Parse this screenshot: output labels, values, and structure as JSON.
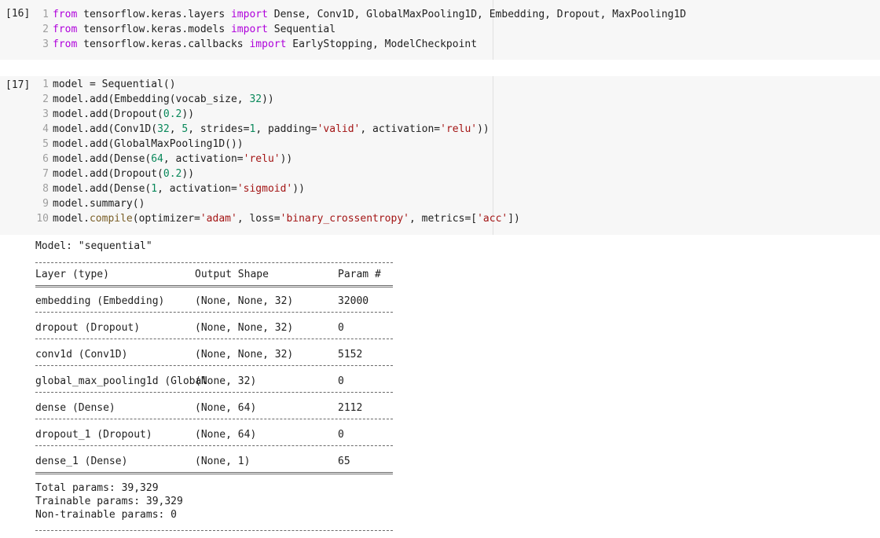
{
  "cells": [
    {
      "label": "[16]",
      "lines": [
        {
          "num": "1",
          "segments": [
            [
              "kw",
              "from"
            ],
            [
              "txt",
              " tensorflow.keras.layers "
            ],
            [
              "kw",
              "import"
            ],
            [
              "txt",
              " Dense, Conv1D, GlobalMaxPooling1D, Embedding, Dropout, MaxPooling1D"
            ]
          ]
        },
        {
          "num": "2",
          "segments": [
            [
              "kw",
              "from"
            ],
            [
              "txt",
              " tensorflow.keras.models "
            ],
            [
              "kw",
              "import"
            ],
            [
              "txt",
              " Sequential"
            ]
          ]
        },
        {
          "num": "3",
          "segments": [
            [
              "kw",
              "from"
            ],
            [
              "txt",
              " tensorflow.keras.callbacks "
            ],
            [
              "kw",
              "import"
            ],
            [
              "txt",
              " EarlyStopping, ModelCheckpoint"
            ]
          ]
        }
      ]
    },
    {
      "label": "[17]",
      "lines": [
        {
          "num": "1",
          "segments": [
            [
              "txt",
              "model = Sequential()"
            ]
          ]
        },
        {
          "num": "2",
          "segments": [
            [
              "txt",
              "model.add(Embedding(vocab_size, "
            ],
            [
              "num",
              "32"
            ],
            [
              "txt",
              "))"
            ]
          ]
        },
        {
          "num": "3",
          "segments": [
            [
              "txt",
              "model.add(Dropout("
            ],
            [
              "num",
              "0.2"
            ],
            [
              "txt",
              "))"
            ]
          ]
        },
        {
          "num": "4",
          "segments": [
            [
              "txt",
              "model.add(Conv1D("
            ],
            [
              "num",
              "32"
            ],
            [
              "txt",
              ", "
            ],
            [
              "num",
              "5"
            ],
            [
              "txt",
              ", strides="
            ],
            [
              "num",
              "1"
            ],
            [
              "txt",
              ", padding="
            ],
            [
              "str",
              "'valid'"
            ],
            [
              "txt",
              ", activation="
            ],
            [
              "str",
              "'relu'"
            ],
            [
              "txt",
              "))"
            ]
          ]
        },
        {
          "num": "5",
          "segments": [
            [
              "txt",
              "model.add(GlobalMaxPooling1D())"
            ]
          ]
        },
        {
          "num": "6",
          "segments": [
            [
              "txt",
              "model.add(Dense("
            ],
            [
              "num",
              "64"
            ],
            [
              "txt",
              ", activation="
            ],
            [
              "str",
              "'relu'"
            ],
            [
              "txt",
              "))"
            ]
          ]
        },
        {
          "num": "7",
          "segments": [
            [
              "txt",
              "model.add(Dropout("
            ],
            [
              "num",
              "0.2"
            ],
            [
              "txt",
              "))"
            ]
          ]
        },
        {
          "num": "8",
          "segments": [
            [
              "txt",
              "model.add(Dense("
            ],
            [
              "num",
              "1"
            ],
            [
              "txt",
              ", activation="
            ],
            [
              "str",
              "'sigmoid'"
            ],
            [
              "txt",
              "))"
            ]
          ]
        },
        {
          "num": "9",
          "segments": [
            [
              "txt",
              "model.summary()"
            ]
          ]
        },
        {
          "num": "10",
          "segments": [
            [
              "txt",
              "model."
            ],
            [
              "fn",
              "compile"
            ],
            [
              "txt",
              "(optimizer="
            ],
            [
              "str",
              "'adam'"
            ],
            [
              "txt",
              ", loss="
            ],
            [
              "str",
              "'binary_crossentropy'"
            ],
            [
              "txt",
              ", metrics=["
            ],
            [
              "str",
              "'acc'"
            ],
            [
              "txt",
              "])"
            ]
          ]
        }
      ]
    }
  ],
  "output": {
    "model_title": "Model: \"sequential\"",
    "headers": [
      "Layer (type)",
      "Output Shape",
      "Param #"
    ],
    "rows": [
      [
        "embedding (Embedding)",
        "(None, None, 32)",
        "32000"
      ],
      [
        "dropout (Dropout)",
        "(None, None, 32)",
        "0"
      ],
      [
        "conv1d (Conv1D)",
        "(None, None, 32)",
        "5152"
      ],
      [
        "global_max_pooling1d (Global",
        "(None, 32)",
        "0"
      ],
      [
        "dense (Dense)",
        "(None, 64)",
        "2112"
      ],
      [
        "dropout_1 (Dropout)",
        "(None, 64)",
        "0"
      ],
      [
        "dense_1 (Dense)",
        "(None, 1)",
        "65"
      ]
    ],
    "total_params": "Total params: 39,329",
    "trainable_params": "Trainable params: 39,329",
    "non_trainable_params": "Non-trainable params: 0"
  }
}
